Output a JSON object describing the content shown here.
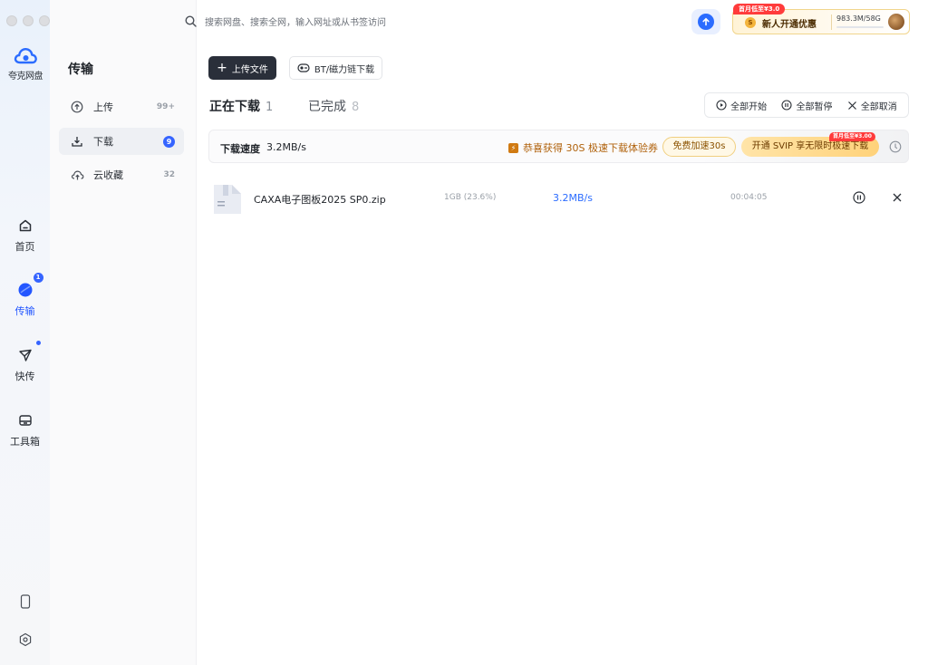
{
  "window": {
    "traffic_lights": [
      "close",
      "minimize",
      "zoom"
    ]
  },
  "rail": {
    "app_name": "夸克网盘",
    "items": [
      {
        "label": "首页",
        "icon": "home-icon"
      },
      {
        "label": "传输",
        "icon": "transfer-icon",
        "badge": "1"
      },
      {
        "label": "快传",
        "icon": "send-icon",
        "dot": true
      },
      {
        "label": "工具箱",
        "icon": "toolbox-icon"
      }
    ],
    "bottom_icons": [
      "phone-icon",
      "settings-icon"
    ]
  },
  "side": {
    "title": "传输",
    "items": [
      {
        "label": "上传",
        "count": "99+",
        "icon": "upload-icon"
      },
      {
        "label": "下载",
        "count": "9",
        "icon": "download-icon",
        "active": true
      },
      {
        "label": "云收藏",
        "count": "32",
        "icon": "cloud-icon"
      }
    ]
  },
  "topbar": {
    "search_placeholder": "搜索网盘、搜索全网，输入网址或从书签访问",
    "promo": {
      "tag": "首月低至¥3.0",
      "coin": "S",
      "text": "新人开通优惠",
      "quota": "983.3M/58G",
      "quota_used_percent": 1.7
    }
  },
  "actions": {
    "upload_label": "上传文件",
    "bt_label": "BT/磁力链下载"
  },
  "tabs": {
    "downloading_label": "正在下载",
    "downloading_count": "1",
    "completed_label": "已完成",
    "completed_count": "8"
  },
  "bulk": {
    "start_all": "全部开始",
    "pause_all": "全部暂停",
    "cancel_all": "全部取消"
  },
  "speedbar": {
    "label": "下载速度",
    "value": "3.2MB/s",
    "congrats": "恭喜获得 30S 极速下载体验券",
    "free_btn": "免费加速30s",
    "svip_btn": "开通 SVIP 享无限时极速下载",
    "svip_tag": "首月低至¥3.00"
  },
  "downloads": [
    {
      "name": "CAXA电子图板2025 SP0.zip",
      "size": "1GB (23.6%)",
      "speed": "3.2MB/s",
      "remaining": "00:04:05"
    }
  ],
  "colors": {
    "accent": "#2b6cff",
    "promo_red": "#ff3b3b",
    "upload_btn": "#2a2f3a"
  }
}
